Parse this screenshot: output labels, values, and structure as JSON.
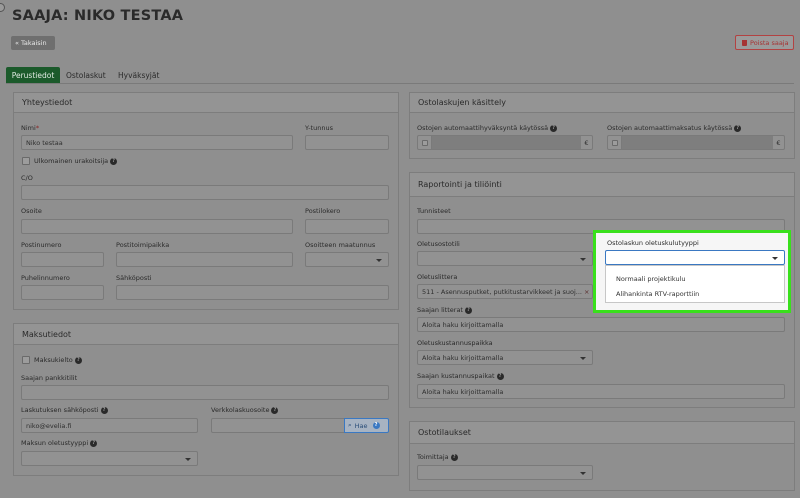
{
  "header": {
    "title": "SAAJA: NIKO TESTAA",
    "back_label": "Takaisin",
    "delete_label": "Poista saaja"
  },
  "tabs": [
    {
      "label": "Perustiedot",
      "active": true
    },
    {
      "label": "Ostolaskut",
      "active": false
    },
    {
      "label": "Hyväksyjät",
      "active": false
    }
  ],
  "yhteystiedot": {
    "title": "Yhteystiedot",
    "nimi_label": "Nimi",
    "nimi_required": "*",
    "nimi_value": "Niko testaa",
    "ytunnus_label": "Y-tunnus",
    "ulkomainen_label": "Ulkomainen urakoitsija",
    "co_label": "C/O",
    "osoite_label": "Osoite",
    "postilokero_label": "Postilokero",
    "postinumero_label": "Postinumero",
    "postitoimipaikka_label": "Postitoimipaikka",
    "maatunnus_label": "Osoitteen maatunnus",
    "puhelin_label": "Puhelinnumero",
    "sahkoposti_label": "Sähköposti"
  },
  "maksutiedot": {
    "title": "Maksutiedot",
    "maksukielto_label": "Maksukielto",
    "pankkitilit_label": "Saajan pankkitilit",
    "laskutus_email_label": "Laskutuksen sähköposti",
    "laskutus_email_value": "niko@evelia.fi",
    "verkkolasku_label": "Verkkolaskuosoite",
    "hae_label": "Hae",
    "oletustyyppi_label": "Maksun oletustyyppi"
  },
  "ostolaskujen_kasittely": {
    "title": "Ostolaskujen käsittely",
    "hyvaksynta_label": "Ostojen automaattihyväksyntä käytössä",
    "maksatus_label": "Ostojen automaattimaksatus käytössä",
    "currency": "€"
  },
  "raportointi": {
    "title": "Raportointi ja tiliöinti",
    "tunnisteet_label": "Tunnisteet",
    "oletusostotili_label": "Oletusostotili",
    "oletuslittera_label": "Oletuslittera",
    "oletuslittera_value": "511 - Asennusputket, putkitustarvikkeet ja suoj...",
    "clear_symbol": "×",
    "saajan_litterat_label": "Saajan litterat",
    "saajan_litterat_placeholder": "Aloita haku kirjoittamalla",
    "oletuskustannuspaikka_label": "Oletuskustannuspaikka",
    "oletuskustannuspaikka_placeholder": "Aloita haku kirjoittamalla",
    "saajan_kustannuspaikat_label": "Saajan kustannuspaikat",
    "saajan_kustannuspaikat_placeholder": "Aloita haku kirjoittamalla",
    "kulutyyppi_label": "Ostolaskun oletuskulutyyppi",
    "kulutyyppi_options": [
      "Normaali projektikulu",
      "Alihankinta RTV-raporttiin"
    ]
  },
  "ostotilaukset": {
    "title": "Ostotilaukset",
    "toimittaja_label": "Toimittaja"
  },
  "icons": {
    "help": "?",
    "back": "«",
    "search": "⌕",
    "trash": "🗑"
  },
  "colors": {
    "active_tab": "#1b5a2b",
    "highlight": "#39e01c",
    "delete": "#a63232",
    "focus": "#3a78c2"
  }
}
